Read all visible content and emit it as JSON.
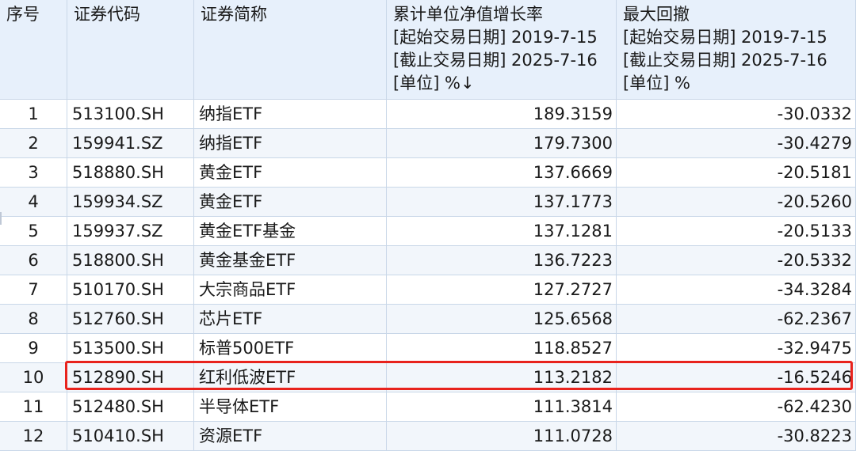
{
  "header": {
    "col_index": "序号",
    "col_code": "证券代码",
    "col_name": "证券简称",
    "col_growth": [
      "累计单位净值增长率",
      "[起始交易日期] 2019-7-15",
      "[截止交易日期] 2025-7-16",
      "[单位] %↓"
    ],
    "col_drawdown": [
      "最大回撤",
      "[起始交易日期] 2019-7-15",
      "[截止交易日期] 2025-7-16",
      "[单位] %"
    ]
  },
  "rows": [
    {
      "idx": "1",
      "code": "513100.SH",
      "name": "纳指ETF",
      "growth": "189.3159",
      "drawdown": "-30.0332"
    },
    {
      "idx": "2",
      "code": "159941.SZ",
      "name": "纳指ETF",
      "growth": "179.7300",
      "drawdown": "-30.4279"
    },
    {
      "idx": "3",
      "code": "518880.SH",
      "name": "黄金ETF",
      "growth": "137.6669",
      "drawdown": "-20.5181"
    },
    {
      "idx": "4",
      "code": "159934.SZ",
      "name": "黄金ETF",
      "growth": "137.1773",
      "drawdown": "-20.5260"
    },
    {
      "idx": "5",
      "code": "159937.SZ",
      "name": "黄金ETF基金",
      "growth": "137.1281",
      "drawdown": "-20.5133"
    },
    {
      "idx": "6",
      "code": "518800.SH",
      "name": "黄金基金ETF",
      "growth": "136.7223",
      "drawdown": "-20.5332"
    },
    {
      "idx": "7",
      "code": "510170.SH",
      "name": "大宗商品ETF",
      "growth": "127.2727",
      "drawdown": "-34.3284"
    },
    {
      "idx": "8",
      "code": "512760.SH",
      "name": "芯片ETF",
      "growth": "125.6568",
      "drawdown": "-62.2367"
    },
    {
      "idx": "9",
      "code": "513500.SH",
      "name": "标普500ETF",
      "growth": "118.8527",
      "drawdown": "-32.9475"
    },
    {
      "idx": "10",
      "code": "512890.SH",
      "name": "红利低波ETF",
      "growth": "113.2182",
      "drawdown": "-16.5246"
    },
    {
      "idx": "11",
      "code": "512480.SH",
      "name": "半导体ETF",
      "growth": "111.3814",
      "drawdown": "-62.4230"
    },
    {
      "idx": "12",
      "code": "510410.SH",
      "name": "资源ETF",
      "growth": "111.0728",
      "drawdown": "-30.8223"
    }
  ],
  "colors": {
    "header_bg": "#e7f0fb",
    "alt_row_bg": "#f2f6fb",
    "grid_line": "#c9d7e8",
    "highlight_border": "#e8231d"
  }
}
